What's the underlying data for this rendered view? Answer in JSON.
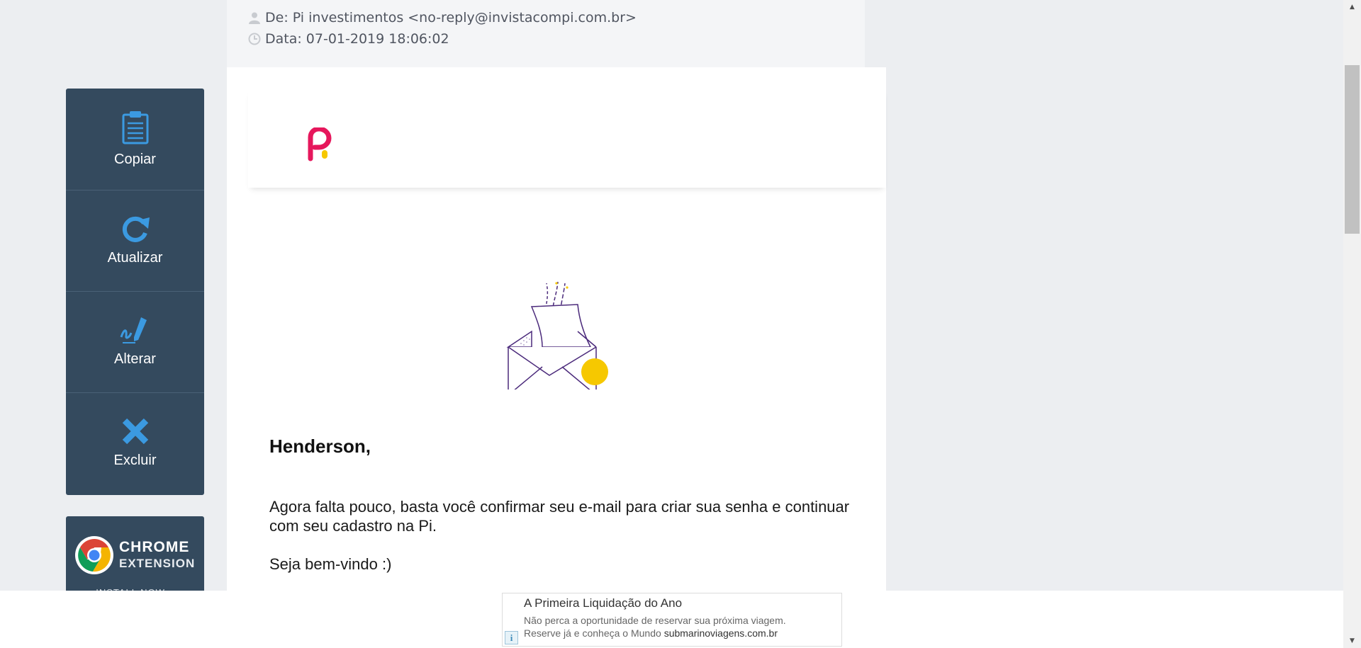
{
  "header": {
    "from": "De: Pi investimentos <no-reply@invistacompi.com.br>",
    "date": "Data: 07-01-2019 18:06:02"
  },
  "toolbar": {
    "items": [
      {
        "label": "Copiar",
        "icon": "clipboard-icon"
      },
      {
        "label": "Atualizar",
        "icon": "refresh-icon"
      },
      {
        "label": "Alterar",
        "icon": "edit-pen-icon"
      },
      {
        "label": "Excluir",
        "icon": "close-icon"
      }
    ]
  },
  "chrome_extension": {
    "line1": "CHROME",
    "line2": "EXTENSION",
    "line3": "INSTALL NOW »"
  },
  "email": {
    "greeting": "Henderson,",
    "paragraph": "Agora falta pouco, basta você confirmar seu e-mail para criar sua senha e continuar com seu cadastro na Pi.",
    "welcome": "Seja bem-vindo :)"
  },
  "ad": {
    "title": "A Primeira Liquidação do Ano",
    "line1": "Não perca a oportunidade de reservar sua próxima viagem.",
    "line2_prefix": "Reserve já e conheça o Mundo ",
    "line2_domain": "submarinoviagens.com.br",
    "info_glyph": "i"
  },
  "colors": {
    "toolbar_bg": "#344a5e",
    "icon_blue": "#3b9ae1",
    "brand_pink": "#e6175c",
    "brand_yellow": "#f6c800",
    "envelope_purple": "#4b2a7b"
  }
}
